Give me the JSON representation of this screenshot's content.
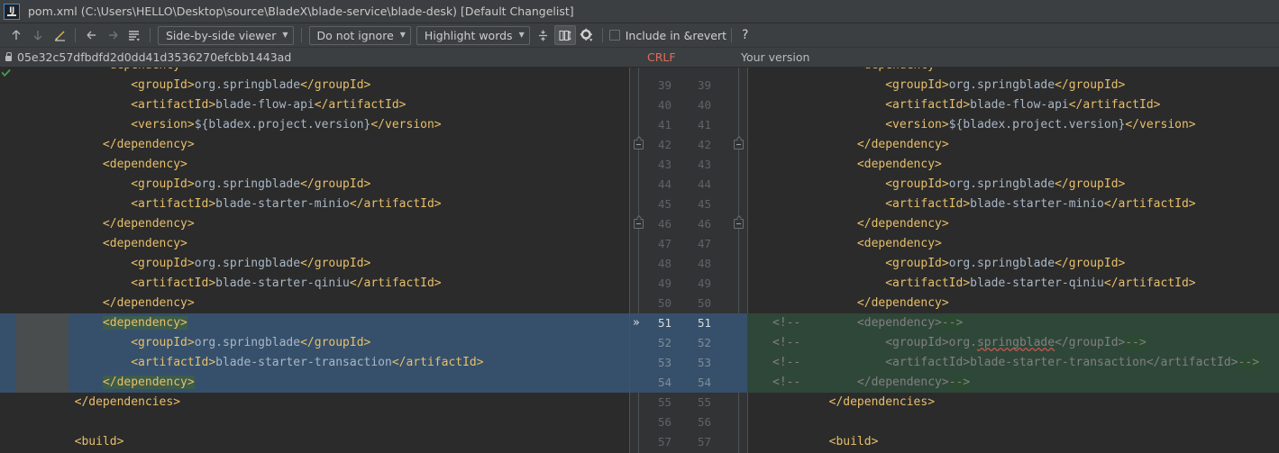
{
  "window": {
    "app_icon": "intellij-idea-logo",
    "title": "pom.xml (C:\\Users\\HELLO\\Desktop\\source\\BladeX\\blade-service\\blade-desk) [Default Changelist]"
  },
  "toolbar": {
    "prev_difference_icon": "arrow-up-icon",
    "next_difference_icon": "arrow-down-icon",
    "edit_source_icon": "pencil-edit-icon",
    "accept_left_icon": "arrow-left-icon",
    "accept_right_icon": "arrow-right-icon",
    "revert_list_icon": "lines-with-caret-icon",
    "viewer_mode": "Side-by-side viewer",
    "ignore_policy": "Do not ignore",
    "highlight_policy": "Highlight words",
    "collapse_unchanged_icon": "collapse-lines-icon",
    "sync_scroll_icon": "synchronize-scroll-icon",
    "settings_icon": "gear-icon",
    "include_in_revert_label": "Include in &revert",
    "include_in_revert_checked": false,
    "help_label": "?"
  },
  "revision_bar": {
    "lock_icon": "lock-icon",
    "hash": "05e32c57dfbdfd2d0dd41d3536270efcbb1443ad",
    "line_separator_badge": "CRLF",
    "right_pane_title": "Your version"
  },
  "gutter": {
    "line_numbers_left": [
      "39",
      "40",
      "41",
      "42",
      "43",
      "44",
      "45",
      "46",
      "47",
      "48",
      "49",
      "50",
      "51",
      "52",
      "53",
      "54",
      "55",
      "56",
      "57"
    ],
    "line_numbers_right": [
      "39",
      "40",
      "41",
      "42",
      "43",
      "44",
      "45",
      "46",
      "47",
      "48",
      "49",
      "50",
      "51",
      "52",
      "53",
      "54",
      "55",
      "56",
      "57"
    ],
    "fold_marker_lines": [
      "42",
      "46"
    ],
    "apply_change_arrow_line": "51",
    "apply_change_arrow_glyph": "»",
    "changed_block_lines": [
      "51",
      "52",
      "53",
      "54"
    ]
  },
  "left_pane": {
    "label": "05e32c57dfbdfd2d0dd41d3536270efcbb1443ad",
    "lines": [
      {
        "n": "38p",
        "indent": 3,
        "parts": [
          {
            "t": "tag",
            "v": "<dependency>"
          }
        ],
        "partial_top": true
      },
      {
        "n": "39",
        "indent": 4,
        "parts": [
          {
            "t": "tag",
            "v": "<groupId>"
          },
          {
            "t": "text",
            "v": "org.springblade"
          },
          {
            "t": "tag",
            "v": "</groupId>"
          }
        ]
      },
      {
        "n": "40",
        "indent": 4,
        "parts": [
          {
            "t": "tag",
            "v": "<artifactId>"
          },
          {
            "t": "text",
            "v": "blade-flow-api"
          },
          {
            "t": "tag",
            "v": "</artifactId>"
          }
        ]
      },
      {
        "n": "41",
        "indent": 4,
        "parts": [
          {
            "t": "tag",
            "v": "<version>"
          },
          {
            "t": "text",
            "v": "${bladex.project.version}"
          },
          {
            "t": "tag",
            "v": "</version>"
          }
        ]
      },
      {
        "n": "42",
        "indent": 3,
        "parts": [
          {
            "t": "tag",
            "v": "</dependency>"
          }
        ]
      },
      {
        "n": "43",
        "indent": 3,
        "parts": [
          {
            "t": "tag",
            "v": "<dependency>"
          }
        ]
      },
      {
        "n": "44",
        "indent": 4,
        "parts": [
          {
            "t": "tag",
            "v": "<groupId>"
          },
          {
            "t": "text",
            "v": "org.springblade"
          },
          {
            "t": "tag",
            "v": "</groupId>"
          }
        ]
      },
      {
        "n": "45",
        "indent": 4,
        "parts": [
          {
            "t": "tag",
            "v": "<artifactId>"
          },
          {
            "t": "text",
            "v": "blade-starter-minio"
          },
          {
            "t": "tag",
            "v": "</artifactId>"
          }
        ]
      },
      {
        "n": "46",
        "indent": 3,
        "parts": [
          {
            "t": "tag",
            "v": "</dependency>"
          }
        ]
      },
      {
        "n": "47",
        "indent": 3,
        "parts": [
          {
            "t": "tag",
            "v": "<dependency>"
          }
        ]
      },
      {
        "n": "48",
        "indent": 4,
        "parts": [
          {
            "t": "tag",
            "v": "<groupId>"
          },
          {
            "t": "text",
            "v": "org.springblade"
          },
          {
            "t": "tag",
            "v": "</groupId>"
          }
        ]
      },
      {
        "n": "49",
        "indent": 4,
        "parts": [
          {
            "t": "tag",
            "v": "<artifactId>"
          },
          {
            "t": "text",
            "v": "blade-starter-qiniu"
          },
          {
            "t": "tag",
            "v": "</artifactId>"
          }
        ]
      },
      {
        "n": "50",
        "indent": 3,
        "parts": [
          {
            "t": "tag",
            "v": "</dependency>"
          }
        ]
      },
      {
        "n": "51",
        "indent": 3,
        "changed": true,
        "parts": [
          {
            "t": "tag",
            "v": "<dependency>",
            "wd": true
          }
        ]
      },
      {
        "n": "52",
        "indent": 4,
        "changed": true,
        "parts": [
          {
            "t": "tag",
            "v": "<groupId>"
          },
          {
            "t": "text",
            "v": "org.springblade"
          },
          {
            "t": "tag",
            "v": "</groupId>"
          }
        ]
      },
      {
        "n": "53",
        "indent": 4,
        "changed": true,
        "parts": [
          {
            "t": "tag",
            "v": "<artifactId>"
          },
          {
            "t": "text",
            "v": "blade-starter-transaction"
          },
          {
            "t": "tag",
            "v": "</artifactId>"
          }
        ]
      },
      {
        "n": "54",
        "indent": 3,
        "changed": true,
        "parts": [
          {
            "t": "tag",
            "v": "</dependency>",
            "wd": true
          }
        ]
      },
      {
        "n": "55",
        "indent": 2,
        "parts": [
          {
            "t": "tag",
            "v": "</dependencies>"
          }
        ]
      },
      {
        "n": "56",
        "indent": 0,
        "parts": []
      },
      {
        "n": "57",
        "indent": 2,
        "parts": [
          {
            "t": "tag",
            "v": "<build>"
          }
        ]
      }
    ]
  },
  "right_pane": {
    "label": "Your version",
    "lines": [
      {
        "n": "38p",
        "indent": 3,
        "parts": [
          {
            "t": "tag",
            "v": "<dependency>"
          }
        ],
        "partial_top": true
      },
      {
        "n": "39",
        "indent": 4,
        "parts": [
          {
            "t": "tag",
            "v": "<groupId>"
          },
          {
            "t": "text",
            "v": "org.springblade"
          },
          {
            "t": "tag",
            "v": "</groupId>"
          }
        ]
      },
      {
        "n": "40",
        "indent": 4,
        "parts": [
          {
            "t": "tag",
            "v": "<artifactId>"
          },
          {
            "t": "text",
            "v": "blade-flow-api"
          },
          {
            "t": "tag",
            "v": "</artifactId>"
          }
        ]
      },
      {
        "n": "41",
        "indent": 4,
        "parts": [
          {
            "t": "tag",
            "v": "<version>"
          },
          {
            "t": "text",
            "v": "${bladex.project.version}"
          },
          {
            "t": "tag",
            "v": "</version>"
          }
        ]
      },
      {
        "n": "42",
        "indent": 3,
        "parts": [
          {
            "t": "tag",
            "v": "</dependency>"
          }
        ]
      },
      {
        "n": "43",
        "indent": 3,
        "parts": [
          {
            "t": "tag",
            "v": "<dependency>"
          }
        ]
      },
      {
        "n": "44",
        "indent": 4,
        "parts": [
          {
            "t": "tag",
            "v": "<groupId>"
          },
          {
            "t": "text",
            "v": "org.springblade"
          },
          {
            "t": "tag",
            "v": "</groupId>"
          }
        ]
      },
      {
        "n": "45",
        "indent": 4,
        "parts": [
          {
            "t": "tag",
            "v": "<artifactId>"
          },
          {
            "t": "text",
            "v": "blade-starter-minio"
          },
          {
            "t": "tag",
            "v": "</artifactId>"
          }
        ]
      },
      {
        "n": "46",
        "indent": 3,
        "parts": [
          {
            "t": "tag",
            "v": "</dependency>"
          }
        ]
      },
      {
        "n": "47",
        "indent": 3,
        "parts": [
          {
            "t": "tag",
            "v": "<dependency>"
          }
        ]
      },
      {
        "n": "48",
        "indent": 4,
        "parts": [
          {
            "t": "tag",
            "v": "<groupId>"
          },
          {
            "t": "text",
            "v": "org.springblade"
          },
          {
            "t": "tag",
            "v": "</groupId>"
          }
        ]
      },
      {
        "n": "49",
        "indent": 4,
        "parts": [
          {
            "t": "tag",
            "v": "<artifactId>"
          },
          {
            "t": "text",
            "v": "blade-starter-qiniu"
          },
          {
            "t": "tag",
            "v": "</artifactId>"
          }
        ]
      },
      {
        "n": "50",
        "indent": 3,
        "parts": [
          {
            "t": "tag",
            "v": "</dependency>"
          }
        ]
      },
      {
        "n": "51",
        "indent": 0,
        "changed": true,
        "comment": true,
        "parts": [
          {
            "t": "cm",
            "v": "<!--",
            "wd": false
          },
          {
            "t": "cm",
            "v": "        <dependency>"
          },
          {
            "t": "cm",
            "v": "-->",
            "wd": true
          }
        ]
      },
      {
        "n": "52",
        "indent": 0,
        "changed": true,
        "comment": true,
        "parts": [
          {
            "t": "cm",
            "v": "<!--",
            "wd": false
          },
          {
            "t": "cm",
            "v": "            <groupId>org."
          },
          {
            "t": "cm",
            "v": "springblade",
            "spell": true
          },
          {
            "t": "cm",
            "v": "</groupId>"
          },
          {
            "t": "cm",
            "v": "-->",
            "wd": true
          }
        ]
      },
      {
        "n": "53",
        "indent": 0,
        "changed": true,
        "comment": true,
        "parts": [
          {
            "t": "cm",
            "v": "<!--",
            "wd": false
          },
          {
            "t": "cm",
            "v": "            <artifactId>blade-starter-transaction</artifactId>"
          },
          {
            "t": "cm",
            "v": "-->",
            "wd": true
          }
        ]
      },
      {
        "n": "54",
        "indent": 0,
        "changed": true,
        "comment": true,
        "parts": [
          {
            "t": "cm",
            "v": "<!--",
            "wd": false
          },
          {
            "t": "cm",
            "v": "        </dependency>"
          },
          {
            "t": "cm",
            "v": "-->",
            "wd": true
          }
        ]
      },
      {
        "n": "55",
        "indent": 2,
        "parts": [
          {
            "t": "tag",
            "v": "</dependencies>"
          }
        ]
      },
      {
        "n": "56",
        "indent": 0,
        "parts": []
      },
      {
        "n": "57",
        "indent": 2,
        "parts": [
          {
            "t": "tag",
            "v": "<build>"
          }
        ]
      }
    ]
  },
  "colors": {
    "background": "#2b2b2b",
    "chrome": "#3c3f41",
    "gutter": "#313335",
    "tag": "#e8bf6a",
    "text": "#a9b7c6",
    "comment": "#808080",
    "changed_left": "#36506b",
    "changed_right": "#2f4739",
    "word_diff_left": "#3d5c4a",
    "word_diff_right": "#2c4a31",
    "selection": "#4a4d4e",
    "crlf": "#e06c5e",
    "accent": "#4a88c7"
  }
}
